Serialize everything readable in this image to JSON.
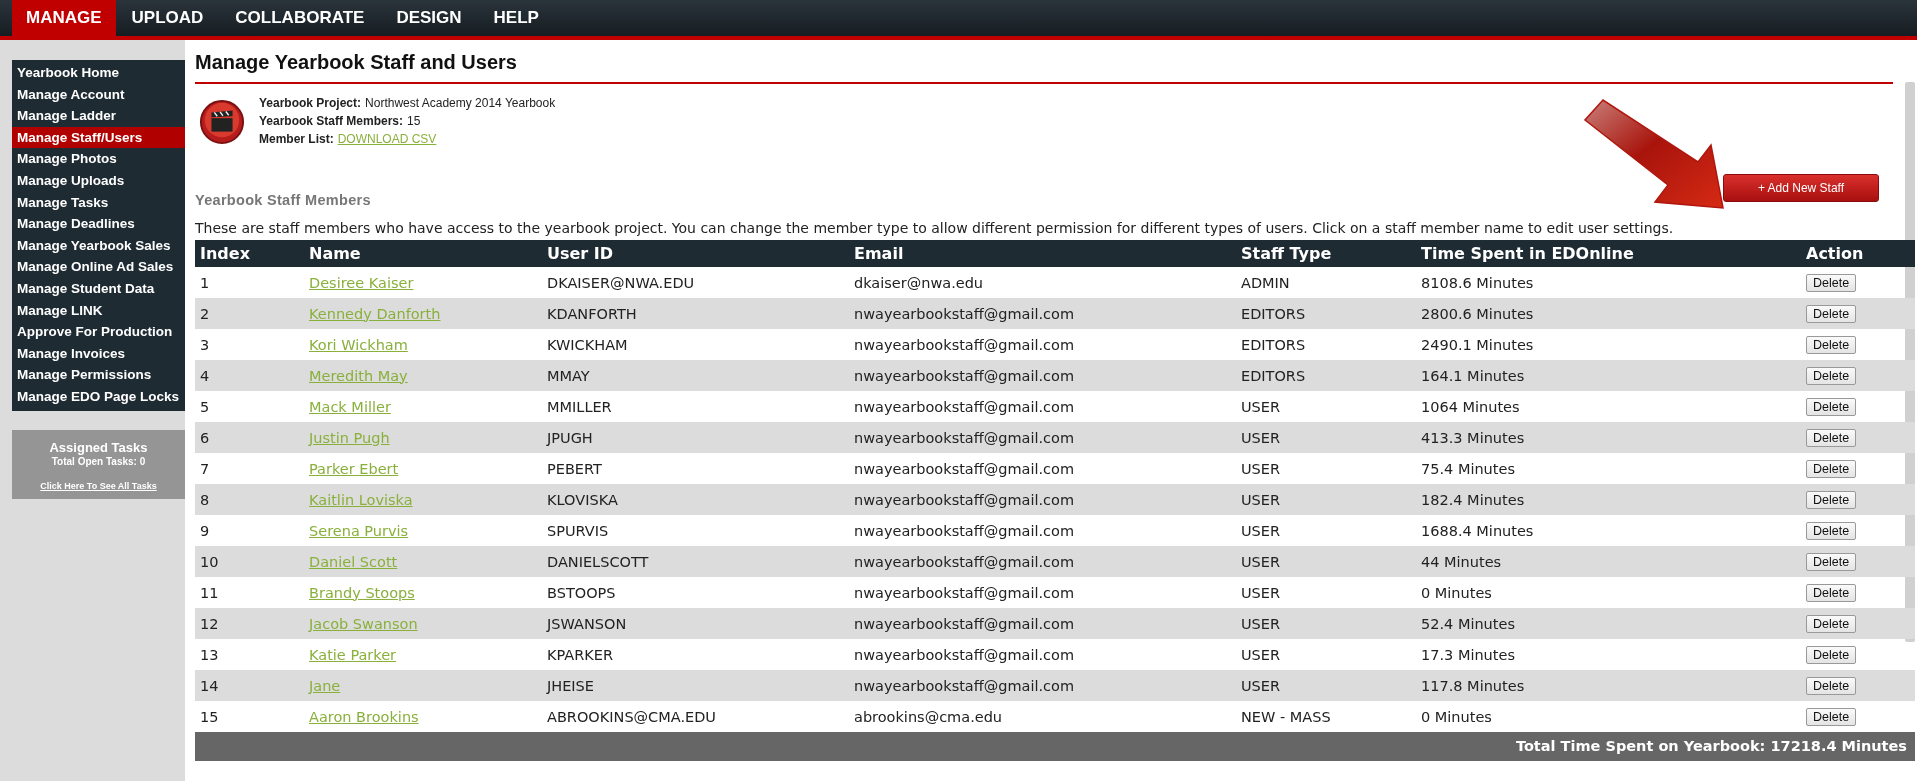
{
  "top_nav": [
    {
      "label": "MANAGE",
      "selected": true
    },
    {
      "label": "UPLOAD",
      "selected": false
    },
    {
      "label": "COLLABORATE",
      "selected": false
    },
    {
      "label": "DESIGN",
      "selected": false
    },
    {
      "label": "HELP",
      "selected": false
    }
  ],
  "sidebar": {
    "items": [
      {
        "label": "Yearbook Home",
        "selected": false
      },
      {
        "label": "Manage Account",
        "selected": false
      },
      {
        "label": "Manage Ladder",
        "selected": false
      },
      {
        "label": "Manage Staff/Users",
        "selected": true
      },
      {
        "label": "Manage Photos",
        "selected": false
      },
      {
        "label": "Manage Uploads",
        "selected": false
      },
      {
        "label": "Manage Tasks",
        "selected": false
      },
      {
        "label": "Manage Deadlines",
        "selected": false
      },
      {
        "label": "Manage Yearbook Sales",
        "selected": false
      },
      {
        "label": "Manage Online Ad Sales",
        "selected": false
      },
      {
        "label": "Manage Student Data",
        "selected": false
      },
      {
        "label": "Manage LINK",
        "selected": false
      },
      {
        "label": "Approve For Production",
        "selected": false
      },
      {
        "label": "Manage Invoices",
        "selected": false
      },
      {
        "label": "Manage Permissions",
        "selected": false
      },
      {
        "label": "Manage EDO Page Locks",
        "selected": false
      }
    ],
    "tasks": {
      "title": "Assigned Tasks",
      "open_tasks": "Total Open Tasks: 0",
      "link": "Click Here To See All Tasks"
    }
  },
  "page_title": "Manage Yearbook Staff and Users",
  "project_info": [
    {
      "label": "Yearbook Project:",
      "value": "Northwest Academy 2014 Yearbook",
      "kind": "text"
    },
    {
      "label": "Yearbook Staff Members:",
      "value": "15",
      "kind": "text"
    },
    {
      "label": "Member List:",
      "value": "DOWNLOAD CSV",
      "kind": "link"
    }
  ],
  "section_heading": "Yearbook Staff Members",
  "add_button": "+ Add New Staff",
  "description": "These are staff members who have access to the yearbook project. You can change the member type to allow different permission for different types of users. Click on a staff member name to edit user settings.",
  "table": {
    "columns": [
      "Index",
      "Name",
      "User ID",
      "Email",
      "Staff Type",
      "Time Spent in EDOnline",
      "Action"
    ],
    "rows": [
      {
        "index": "1",
        "name": "Desiree Kaiser",
        "user_id": "DKAISER@NWA.EDU",
        "email": "dkaiser@nwa.edu",
        "staff_type": "ADMIN",
        "time": "8108.6 Minutes",
        "action": "Delete"
      },
      {
        "index": "2",
        "name": "Kennedy Danforth",
        "user_id": "KDANFORTH",
        "email": "nwayearbookstaff@gmail.com",
        "staff_type": "EDITORS",
        "time": "2800.6 Minutes",
        "action": "Delete"
      },
      {
        "index": "3",
        "name": "Kori Wickham",
        "user_id": "KWICKHAM",
        "email": "nwayearbookstaff@gmail.com",
        "staff_type": "EDITORS",
        "time": "2490.1 Minutes",
        "action": "Delete"
      },
      {
        "index": "4",
        "name": "Meredith May",
        "user_id": "MMAY",
        "email": "nwayearbookstaff@gmail.com",
        "staff_type": "EDITORS",
        "time": "164.1 Minutes",
        "action": "Delete"
      },
      {
        "index": "5",
        "name": "Mack Miller",
        "user_id": "MMILLER",
        "email": "nwayearbookstaff@gmail.com",
        "staff_type": "USER",
        "time": "1064 Minutes",
        "action": "Delete"
      },
      {
        "index": "6",
        "name": "Justin Pugh",
        "user_id": "JPUGH",
        "email": "nwayearbookstaff@gmail.com",
        "staff_type": "USER",
        "time": "413.3 Minutes",
        "action": "Delete"
      },
      {
        "index": "7",
        "name": "Parker Ebert",
        "user_id": "PEBERT",
        "email": "nwayearbookstaff@gmail.com",
        "staff_type": "USER",
        "time": "75.4 Minutes",
        "action": "Delete"
      },
      {
        "index": "8",
        "name": "Kaitlin Loviska",
        "user_id": "KLOVISKA",
        "email": "nwayearbookstaff@gmail.com",
        "staff_type": "USER",
        "time": "182.4 Minutes",
        "action": "Delete"
      },
      {
        "index": "9",
        "name": "Serena Purvis",
        "user_id": "SPURVIS",
        "email": "nwayearbookstaff@gmail.com",
        "staff_type": "USER",
        "time": "1688.4 Minutes",
        "action": "Delete"
      },
      {
        "index": "10",
        "name": "Daniel Scott",
        "user_id": "DANIELSCOTT",
        "email": "nwayearbookstaff@gmail.com",
        "staff_type": "USER",
        "time": "44 Minutes",
        "action": "Delete"
      },
      {
        "index": "11",
        "name": "Brandy Stoops",
        "user_id": "BSTOOPS",
        "email": "nwayearbookstaff@gmail.com",
        "staff_type": "USER",
        "time": "0 Minutes",
        "action": "Delete"
      },
      {
        "index": "12",
        "name": "Jacob Swanson",
        "user_id": "JSWANSON",
        "email": "nwayearbookstaff@gmail.com",
        "staff_type": "USER",
        "time": "52.4 Minutes",
        "action": "Delete"
      },
      {
        "index": "13",
        "name": "Katie Parker",
        "user_id": "KPARKER",
        "email": "nwayearbookstaff@gmail.com",
        "staff_type": "USER",
        "time": "17.3 Minutes",
        "action": "Delete"
      },
      {
        "index": "14",
        "name": "Jane",
        "user_id": "JHEISE",
        "email": "nwayearbookstaff@gmail.com",
        "staff_type": "USER",
        "time": "117.8 Minutes",
        "action": "Delete"
      },
      {
        "index": "15",
        "name": "Aaron Brookins",
        "user_id": "ABROOKINS@CMA.EDU",
        "email": "abrookins@cma.edu",
        "staff_type": "NEW - MASS",
        "time": "0 Minutes",
        "action": "Delete"
      }
    ],
    "footer": "Total Time Spent on Yearbook: 17218.4 Minutes"
  }
}
